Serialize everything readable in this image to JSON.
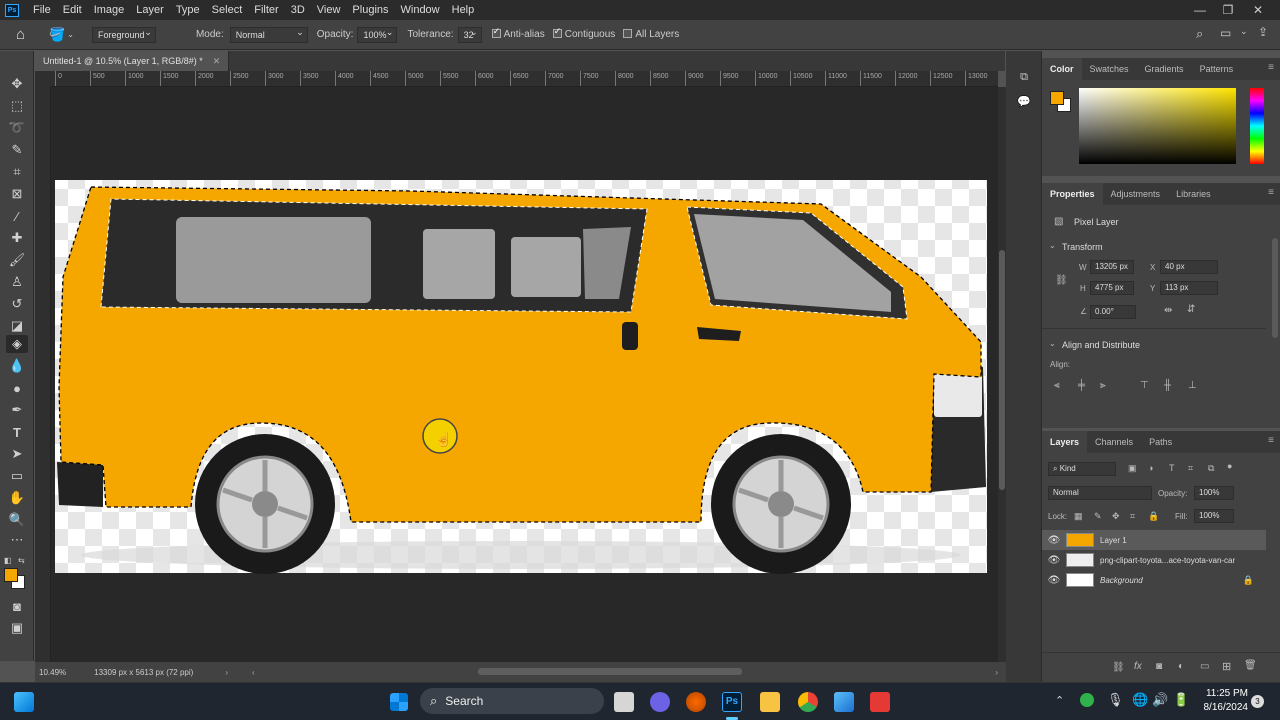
{
  "menubar": {
    "app_badge": "Ps",
    "items": [
      "File",
      "Edit",
      "Image",
      "Layer",
      "Type",
      "Select",
      "Filter",
      "3D",
      "View",
      "Plugins",
      "Window",
      "Help"
    ]
  },
  "options": {
    "fill_source": "Foreground",
    "mode_label": "Mode:",
    "mode_value": "Normal",
    "opacity_label": "Opacity:",
    "opacity_value": "100%",
    "tolerance_label": "Tolerance:",
    "tolerance_value": "32",
    "anti_alias": "Anti-alias",
    "contiguous": "Contiguous",
    "all_layers": "All Layers"
  },
  "document": {
    "tab_title": "Untitled-1 @ 10.5% (Layer 1, RGB/8#) *",
    "zoom": "10.49%",
    "doc_size": "13309 px x 5613 px (72 ppi)"
  },
  "ruler": {
    "labels": [
      "0",
      "500",
      "1000",
      "1500",
      "2000",
      "2500",
      "3000",
      "3500",
      "4000",
      "4500",
      "5000",
      "5500",
      "6000",
      "6500",
      "7000",
      "7500",
      "8000",
      "8500",
      "9000",
      "9500",
      "10000",
      "10500",
      "11000",
      "11500",
      "12000",
      "12500",
      "13000"
    ]
  },
  "color_panel": {
    "tabs": [
      "Color",
      "Swatches",
      "Gradients",
      "Patterns"
    ],
    "foreground": "#f5a700",
    "background": "#ffffff"
  },
  "properties_panel": {
    "tabs": [
      "Properties",
      "Adjustments",
      "Libraries"
    ],
    "kind": "Pixel Layer",
    "transform_title": "Transform",
    "w_label": "W",
    "w_value": "13205 px",
    "h_label": "H",
    "h_value": "4775 px",
    "x_label": "X",
    "x_value": "40 px",
    "y_label": "Y",
    "y_value": "113 px",
    "angle_value": "0.00°",
    "align_title": "Align and Distribute",
    "align_label": "Align:"
  },
  "layers_panel": {
    "tabs": [
      "Layers",
      "Channels",
      "Paths"
    ],
    "filter_kind": "Kind",
    "blend_mode": "Normal",
    "opacity_label": "Opacity:",
    "opacity_value": "100%",
    "lock_label": "Lock:",
    "fill_label": "Fill:",
    "fill_value": "100%",
    "layers": [
      {
        "name": "Layer 1",
        "selected": true
      },
      {
        "name": "png-clipart-toyota...ace-toyota-van-car",
        "selected": false
      },
      {
        "name": "Background",
        "selected": false,
        "locked": true
      }
    ]
  },
  "taskbar": {
    "search_label": "Search",
    "time": "11:25 PM",
    "date": "8/16/2024",
    "notifications": "3"
  }
}
